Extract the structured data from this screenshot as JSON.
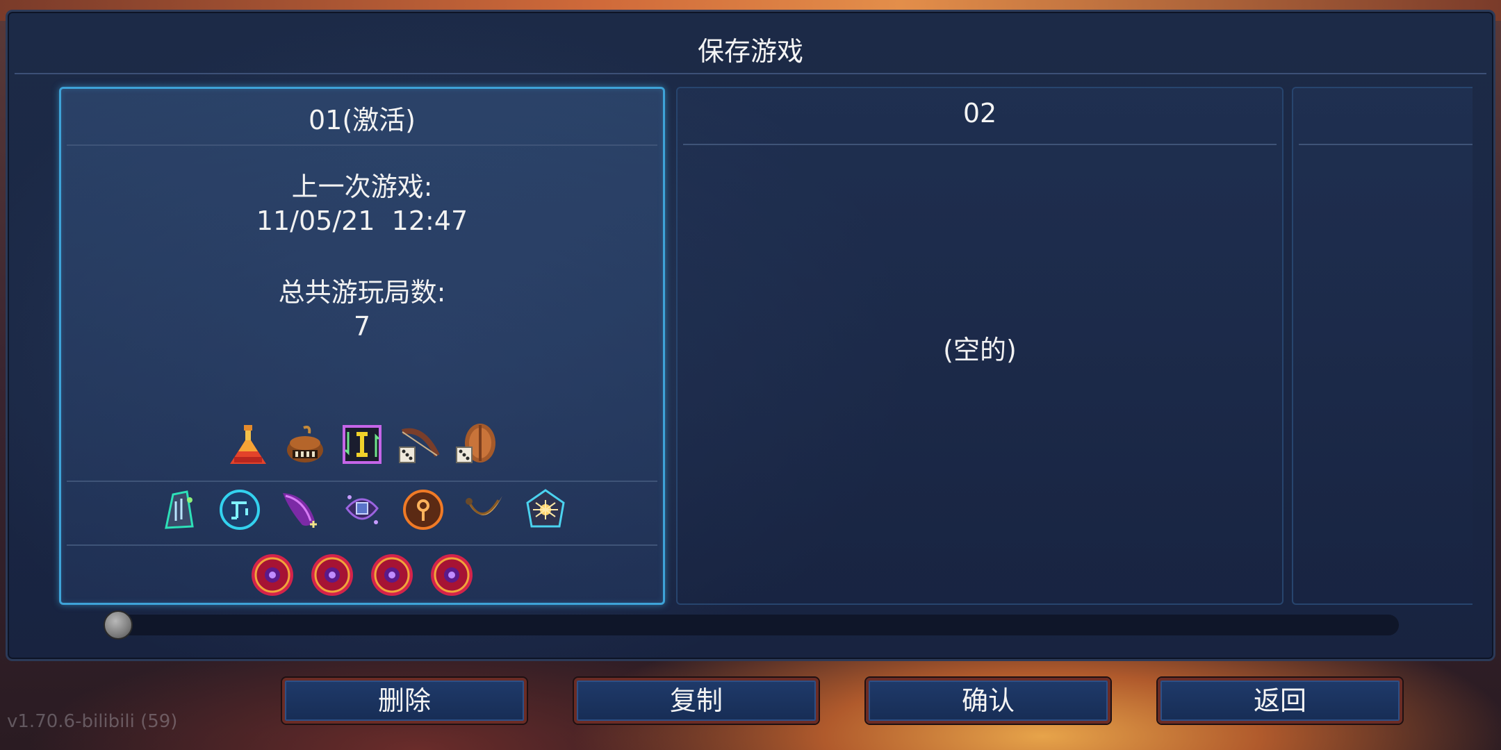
{
  "dialog": {
    "title": "保存游戏"
  },
  "slots": [
    {
      "header": "01(激活)",
      "last_played_label": "上一次游戏:",
      "last_played_value": "11/05/21  12:47",
      "total_runs_label": "总共游玩局数:",
      "total_runs_value": "7",
      "row1_icons": [
        "potion-flask-icon",
        "bomb-barrel-icon",
        "swap-rune-icon",
        "bow-dice-icon",
        "shield-dice-icon"
      ],
      "row2_icons": [
        "green-mutation-icon",
        "blue-teleport-rune-icon",
        "purple-feather-icon",
        "purple-amulet-icon",
        "orange-key-rune-icon",
        "horn-icon",
        "spider-rune-icon"
      ],
      "row3_icons": [
        "boss-cell-icon",
        "boss-cell-icon",
        "boss-cell-icon",
        "boss-cell-icon"
      ]
    },
    {
      "header": "02",
      "empty_text": "(空的)"
    },
    {
      "header": ""
    }
  ],
  "buttons": {
    "delete": "删除",
    "copy": "复制",
    "confirm": "确认",
    "back": "返回"
  },
  "footer": {
    "version": "v1.70.6-bilibili (59)"
  },
  "colors": {
    "active_border": "#3ea3d8",
    "panel_bg": "#1c2a47",
    "button_bg": "#1f3a6a",
    "button_border": "#6b2c25"
  }
}
